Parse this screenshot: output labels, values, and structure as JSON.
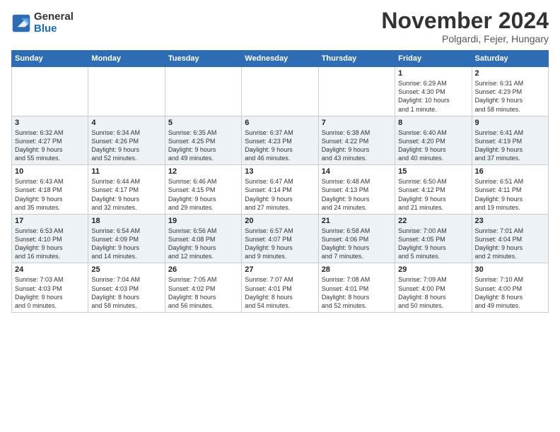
{
  "logo": {
    "general": "General",
    "blue": "Blue"
  },
  "header": {
    "month": "November 2024",
    "location": "Polgardi, Fejer, Hungary"
  },
  "weekdays": [
    "Sunday",
    "Monday",
    "Tuesday",
    "Wednesday",
    "Thursday",
    "Friday",
    "Saturday"
  ],
  "weeks": [
    [
      {
        "day": "",
        "detail": ""
      },
      {
        "day": "",
        "detail": ""
      },
      {
        "day": "",
        "detail": ""
      },
      {
        "day": "",
        "detail": ""
      },
      {
        "day": "",
        "detail": ""
      },
      {
        "day": "1",
        "detail": "Sunrise: 6:29 AM\nSunset: 4:30 PM\nDaylight: 10 hours\nand 1 minute."
      },
      {
        "day": "2",
        "detail": "Sunrise: 6:31 AM\nSunset: 4:29 PM\nDaylight: 9 hours\nand 58 minutes."
      }
    ],
    [
      {
        "day": "3",
        "detail": "Sunrise: 6:32 AM\nSunset: 4:27 PM\nDaylight: 9 hours\nand 55 minutes."
      },
      {
        "day": "4",
        "detail": "Sunrise: 6:34 AM\nSunset: 4:26 PM\nDaylight: 9 hours\nand 52 minutes."
      },
      {
        "day": "5",
        "detail": "Sunrise: 6:35 AM\nSunset: 4:25 PM\nDaylight: 9 hours\nand 49 minutes."
      },
      {
        "day": "6",
        "detail": "Sunrise: 6:37 AM\nSunset: 4:23 PM\nDaylight: 9 hours\nand 46 minutes."
      },
      {
        "day": "7",
        "detail": "Sunrise: 6:38 AM\nSunset: 4:22 PM\nDaylight: 9 hours\nand 43 minutes."
      },
      {
        "day": "8",
        "detail": "Sunrise: 6:40 AM\nSunset: 4:20 PM\nDaylight: 9 hours\nand 40 minutes."
      },
      {
        "day": "9",
        "detail": "Sunrise: 6:41 AM\nSunset: 4:19 PM\nDaylight: 9 hours\nand 37 minutes."
      }
    ],
    [
      {
        "day": "10",
        "detail": "Sunrise: 6:43 AM\nSunset: 4:18 PM\nDaylight: 9 hours\nand 35 minutes."
      },
      {
        "day": "11",
        "detail": "Sunrise: 6:44 AM\nSunset: 4:17 PM\nDaylight: 9 hours\nand 32 minutes."
      },
      {
        "day": "12",
        "detail": "Sunrise: 6:46 AM\nSunset: 4:15 PM\nDaylight: 9 hours\nand 29 minutes."
      },
      {
        "day": "13",
        "detail": "Sunrise: 6:47 AM\nSunset: 4:14 PM\nDaylight: 9 hours\nand 27 minutes."
      },
      {
        "day": "14",
        "detail": "Sunrise: 6:48 AM\nSunset: 4:13 PM\nDaylight: 9 hours\nand 24 minutes."
      },
      {
        "day": "15",
        "detail": "Sunrise: 6:50 AM\nSunset: 4:12 PM\nDaylight: 9 hours\nand 21 minutes."
      },
      {
        "day": "16",
        "detail": "Sunrise: 6:51 AM\nSunset: 4:11 PM\nDaylight: 9 hours\nand 19 minutes."
      }
    ],
    [
      {
        "day": "17",
        "detail": "Sunrise: 6:53 AM\nSunset: 4:10 PM\nDaylight: 9 hours\nand 16 minutes."
      },
      {
        "day": "18",
        "detail": "Sunrise: 6:54 AM\nSunset: 4:09 PM\nDaylight: 9 hours\nand 14 minutes."
      },
      {
        "day": "19",
        "detail": "Sunrise: 6:56 AM\nSunset: 4:08 PM\nDaylight: 9 hours\nand 12 minutes."
      },
      {
        "day": "20",
        "detail": "Sunrise: 6:57 AM\nSunset: 4:07 PM\nDaylight: 9 hours\nand 9 minutes."
      },
      {
        "day": "21",
        "detail": "Sunrise: 6:58 AM\nSunset: 4:06 PM\nDaylight: 9 hours\nand 7 minutes."
      },
      {
        "day": "22",
        "detail": "Sunrise: 7:00 AM\nSunset: 4:05 PM\nDaylight: 9 hours\nand 5 minutes."
      },
      {
        "day": "23",
        "detail": "Sunrise: 7:01 AM\nSunset: 4:04 PM\nDaylight: 9 hours\nand 2 minutes."
      }
    ],
    [
      {
        "day": "24",
        "detail": "Sunrise: 7:03 AM\nSunset: 4:03 PM\nDaylight: 9 hours\nand 0 minutes."
      },
      {
        "day": "25",
        "detail": "Sunrise: 7:04 AM\nSunset: 4:03 PM\nDaylight: 8 hours\nand 58 minutes."
      },
      {
        "day": "26",
        "detail": "Sunrise: 7:05 AM\nSunset: 4:02 PM\nDaylight: 8 hours\nand 56 minutes."
      },
      {
        "day": "27",
        "detail": "Sunrise: 7:07 AM\nSunset: 4:01 PM\nDaylight: 8 hours\nand 54 minutes."
      },
      {
        "day": "28",
        "detail": "Sunrise: 7:08 AM\nSunset: 4:01 PM\nDaylight: 8 hours\nand 52 minutes."
      },
      {
        "day": "29",
        "detail": "Sunrise: 7:09 AM\nSunset: 4:00 PM\nDaylight: 8 hours\nand 50 minutes."
      },
      {
        "day": "30",
        "detail": "Sunrise: 7:10 AM\nSunset: 4:00 PM\nDaylight: 8 hours\nand 49 minutes."
      }
    ]
  ]
}
